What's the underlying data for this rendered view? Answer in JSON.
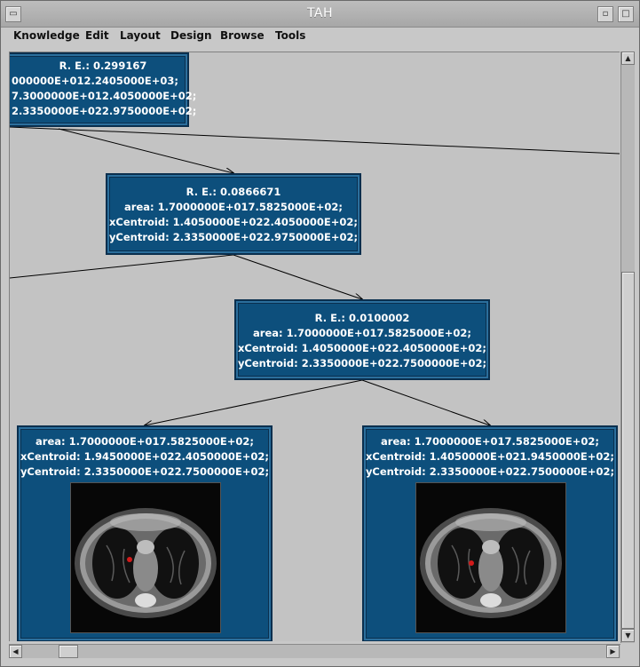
{
  "window": {
    "title": "TAH",
    "sysmenu_icon": "window-menu-icon",
    "min_symbol": "▫",
    "max_symbol": "□"
  },
  "menubar": {
    "items": [
      "Knowledge",
      "Edit",
      "Layout",
      "Design",
      "Browse",
      "Tools"
    ]
  },
  "nodes": {
    "root": {
      "lines": [
        "R. E.: 0.299167",
        "000000E+012.2405000E+03;",
        "7.3000000E+012.4050000E+02;",
        "2.3350000E+022.9750000E+02;"
      ]
    },
    "mid": {
      "lines": [
        "R. E.: 0.0866671",
        "area: 1.7000000E+017.5825000E+02;",
        "xCentroid: 1.4050000E+022.4050000E+02;",
        "yCentroid: 2.3350000E+022.9750000E+02;"
      ]
    },
    "lower": {
      "lines": [
        "R. E.: 0.0100002",
        "area: 1.7000000E+017.5825000E+02;",
        "xCentroid: 1.4050000E+022.4050000E+02;",
        "yCentroid: 2.3350000E+022.7500000E+02;"
      ]
    },
    "leaf_left": {
      "lines": [
        "area: 1.7000000E+017.5825000E+02;",
        "xCentroid: 1.9450000E+022.4050000E+02;",
        "yCentroid: 2.3350000E+022.7500000E+02;"
      ]
    },
    "leaf_right": {
      "lines": [
        "area: 1.7000000E+017.5825000E+02;",
        "xCentroid: 1.4050000E+021.9450000E+02;",
        "yCentroid: 2.3350000E+022.7500000E+02;"
      ]
    }
  },
  "colors": {
    "node_fill": "#0d4f7c",
    "node_border": "#0a2f4e",
    "edge": "#000000",
    "canvas": "#c3c3c3",
    "highlight": "#d21a1a"
  },
  "scroll": {
    "up_arrow": "▲",
    "down_arrow": "▼",
    "left_arrow": "◀",
    "right_arrow": "▶"
  }
}
